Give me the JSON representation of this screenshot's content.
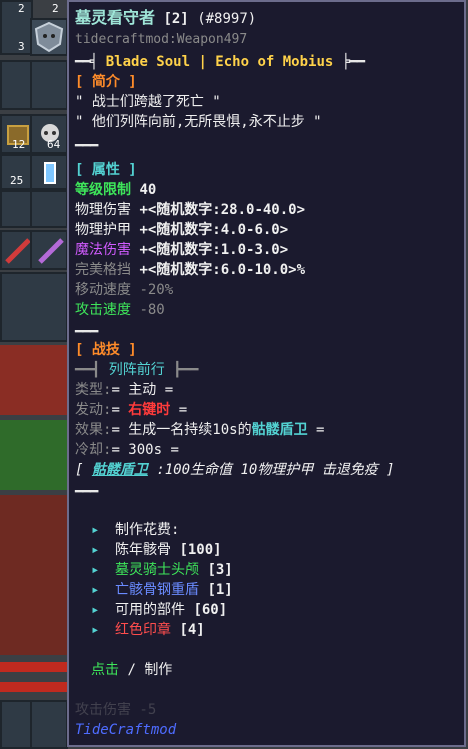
{
  "inventory": {
    "counts": [
      "2",
      "2",
      "3",
      "12",
      "64",
      "25"
    ]
  },
  "tooltip": {
    "title": "墓灵看守者",
    "level": "[2]",
    "id": "(#8997)",
    "source": "tidecraftmod:Weapon497",
    "subtitle": "Blade Soul | Echo of Mobius",
    "intro_header": "[ 简介 ]",
    "intro_line1": "\" 战士们跨越了死亡 \"",
    "intro_line2": "\" 他们列阵向前,无所畏惧,永不止步 \"",
    "divider": "━━━",
    "attr_header": "[ 属性 ]",
    "level_req_label": "等级限制",
    "level_req_value": "40",
    "phys_dmg_label": "物理伤害",
    "phys_dmg_value": "+<随机数字:28.0-40.0>",
    "phys_armor_label": "物理护甲",
    "phys_armor_value": "+<随机数字:4.0-6.0>",
    "magic_dmg_label": "魔法伤害",
    "magic_dmg_value": "+<随机数字:1.0-3.0>",
    "parry_label": "完美格挡",
    "parry_value": "+<随机数字:6.0-10.0>%",
    "move_speed_label": "移动速度",
    "move_speed_value": "-20%",
    "atk_speed_label": "攻击速度",
    "atk_speed_value": "-80",
    "skill_header": "[ 战技 ]",
    "skill_name": "列阵前行",
    "type_label": "类型:",
    "type_value": "= 主动 =",
    "trigger_label": "发动:",
    "trigger_pre": "= ",
    "trigger_value": "右键时",
    "trigger_post": " =",
    "effect_label": "效果:",
    "effect_pre": "= 生成一名持续10s的",
    "effect_highlight": "骷髅盾卫",
    "effect_post": " =",
    "cooldown_label": "冷却:",
    "cooldown_value": "= 300s =",
    "minion_open": "[",
    "minion_name": "骷髅盾卫",
    "minion_desc": ":100生命值 10物理护甲 击退免疫 ]",
    "craft_cost_label": "制作花费:",
    "materials": [
      {
        "name": "陈年骸骨",
        "qty": "[100]",
        "color": "#f0f0f0"
      },
      {
        "name": "墓灵骑士头颅",
        "qty": "[3]",
        "color": "#3ee65a"
      },
      {
        "name": "亡骸骨钢重盾",
        "qty": "[1]",
        "color": "#6a8bff"
      },
      {
        "name": "可用的部件",
        "qty": "[60]",
        "color": "#f0f0f0"
      },
      {
        "name": "红色印章",
        "qty": "[4]",
        "color": "#ff4d4d"
      }
    ],
    "craft_action": "点击",
    "craft_action_sep": "/",
    "craft_action_label": "制作",
    "footer_hidden": "攻击伤害 -5",
    "mod_name": "TideCraftmod"
  },
  "colors": {
    "tooltip_bg": "#1b1a2e",
    "tooltip_border": "#6c6c8c",
    "accent_teal": "#53d2d2",
    "mod_blue": "#4e6cff"
  }
}
